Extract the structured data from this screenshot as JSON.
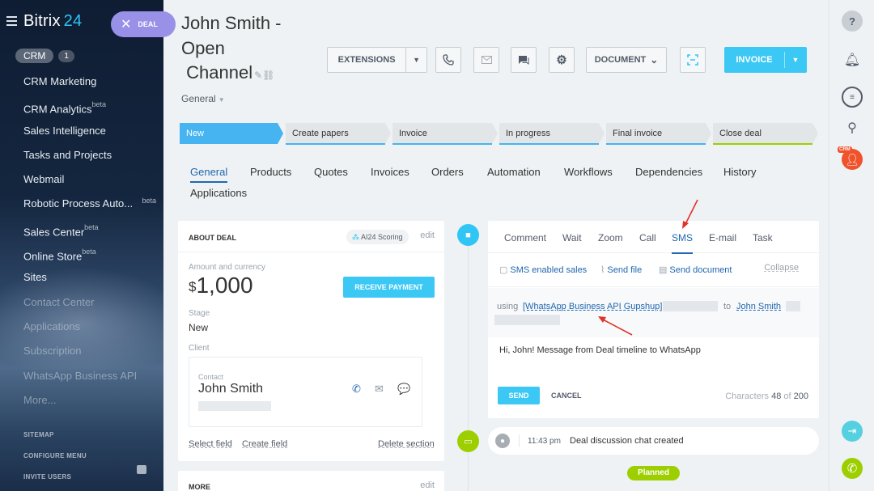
{
  "sidebar": {
    "logo_main": "Bitrix",
    "logo_num": "24",
    "deal_pill": "DEAL",
    "crm_label": "CRM",
    "crm_count": "1",
    "items": [
      {
        "label": "CRM Marketing",
        "beta": ""
      },
      {
        "label": "CRM Analytics",
        "beta": "beta"
      },
      {
        "label": "Sales Intelligence",
        "beta": ""
      },
      {
        "label": "Tasks and Projects",
        "beta": ""
      },
      {
        "label": "Webmail",
        "beta": ""
      },
      {
        "label": "Robotic Process Auto...",
        "beta": "beta"
      },
      {
        "label": "Sales Center",
        "beta": "beta"
      },
      {
        "label": "Online Store",
        "beta": "beta"
      },
      {
        "label": "Sites",
        "beta": ""
      },
      {
        "label": "Contact Center",
        "beta": ""
      },
      {
        "label": "Applications",
        "beta": ""
      },
      {
        "label": "Subscription",
        "beta": ""
      },
      {
        "label": "WhatsApp Business API",
        "beta": ""
      },
      {
        "label": "More...",
        "beta": ""
      }
    ],
    "footer": {
      "sitemap": "SITEMAP",
      "configure": "CONFIGURE MENU",
      "invite": "INVITE USERS"
    }
  },
  "header": {
    "title_line1": "John Smith -",
    "title_line2": "Open",
    "title_line3": "Channel",
    "category": "General",
    "extensions_label": "EXTENSIONS",
    "document_label": "DOCUMENT",
    "invoice_label": "INVOICE"
  },
  "stages": [
    {
      "label": "New",
      "line": "#45b4f0"
    },
    {
      "label": "Create papers",
      "line": "#45b4f0"
    },
    {
      "label": "Invoice",
      "line": "#45b4f0"
    },
    {
      "label": "In progress",
      "line": "#45b4f0"
    },
    {
      "label": "Final invoice",
      "line": "#45b4f0"
    },
    {
      "label": "Close deal",
      "line": "#9dcf00"
    }
  ],
  "tabs": [
    "General",
    "Products",
    "Quotes",
    "Invoices",
    "Orders",
    "Automation",
    "Workflows",
    "Dependencies",
    "History",
    "Applications"
  ],
  "about": {
    "heading": "ABOUT DEAL",
    "ai_badge": "AI24 Scoring",
    "edit": "edit",
    "amount_label": "Amount and currency",
    "currency": "$",
    "amount": "1,000",
    "receive_payment": "RECEIVE PAYMENT",
    "stage_label": "Stage",
    "stage_value": "New",
    "client_label": "Client",
    "contact_label": "Contact",
    "contact_name": "John Smith",
    "select_field": "Select field",
    "create_field": "Create field",
    "delete_section": "Delete section"
  },
  "more": {
    "heading": "MORE",
    "edit": "edit"
  },
  "editor": {
    "tabs": [
      "Comment",
      "Wait",
      "Zoom",
      "Call",
      "SMS",
      "E-mail",
      "Task"
    ],
    "active_tab": "SMS",
    "tools": {
      "sms_enabled": "SMS enabled sales",
      "send_file": "Send file",
      "send_document": "Send document",
      "collapse": "Collapse"
    },
    "using_word": "using",
    "provider": "[WhatsApp Business API Gupshup]",
    "to_word": "to",
    "recipient": "John Smith",
    "message": "Hi, John! Message from Deal timeline to WhatsApp",
    "send": "SEND",
    "cancel": "CANCEL",
    "chars_label": "Characters",
    "chars_count": "48",
    "chars_of": "of",
    "chars_max": "200"
  },
  "event": {
    "time": "11:43 pm",
    "text": "Deal discussion chat created"
  },
  "planned": "Planned",
  "rail": {
    "help_glyph": "?",
    "crm_badge": "CRM"
  },
  "colors": {
    "accent": "#3bc8f5",
    "link": "#2067b0",
    "green": "#9dcf00",
    "deal_pill": "#9990e8",
    "annotation": "#e0332a"
  }
}
